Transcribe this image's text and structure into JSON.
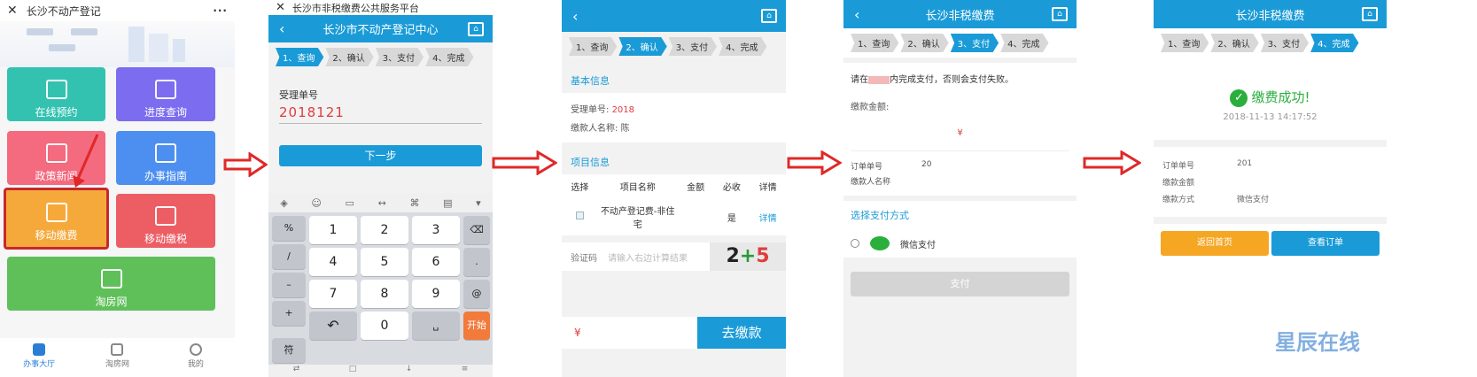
{
  "screen1": {
    "title": "长沙不动产登记",
    "menu": "···",
    "tiles": [
      {
        "label": "在线预约",
        "color": "#33c2b0"
      },
      {
        "label": "进度查询",
        "color": "#7b6cf0"
      },
      {
        "label": "政策新闻",
        "color": "#f46a7e"
      },
      {
        "label": "办事指南",
        "color": "#4d8ff0"
      },
      {
        "label": "移动缴费",
        "color": "#f6a93b"
      },
      {
        "label": "移动缴税",
        "color": "#ec5d64"
      },
      {
        "label": "淘房网",
        "color": "#5fc05a"
      }
    ],
    "nav": [
      "办事大厅",
      "淘房网",
      "我的"
    ]
  },
  "screen2": {
    "browser_title": "长沙市非税缴费公共服务平台",
    "header": "长沙市不动产登记中心",
    "steps": [
      "1、查询",
      "2、确认",
      "3、支付",
      "4、完成"
    ],
    "field_label": "受理单号",
    "field_value": "2018121",
    "next_button": "下一步",
    "keys_left": [
      "%",
      "/",
      "–",
      "+",
      "符"
    ],
    "keys_digits": [
      "1",
      "2",
      "3",
      "4",
      "5",
      "6",
      "7",
      "8",
      "9",
      "0"
    ],
    "keys_right": [
      ".",
      "@",
      "开始"
    ]
  },
  "screen3": {
    "steps": [
      "1、查询",
      "2、确认",
      "3、支付",
      "4、完成"
    ],
    "section_basic": "基本信息",
    "receipt_label": "受理单号:",
    "receipt_value": "2018",
    "payer_label": "缴款人名称:",
    "payer_value": "陈",
    "section_items": "项目信息",
    "table_headers": [
      "选择",
      "项目名称",
      "金额",
      "必收",
      "详情"
    ],
    "item_name": "不动产登记费-非住宅",
    "item_required": "是",
    "item_detail": "详情",
    "captcha_label": "验证码",
    "captcha_placeholder": "请输入右边计算结果",
    "captcha_a": "2",
    "captcha_b": "+",
    "captcha_c": "5",
    "currency": "¥",
    "pay_button": "去缴款"
  },
  "screen4": {
    "header": "长沙非税缴费",
    "steps": [
      "1、查询",
      "2、确认",
      "3、支付",
      "4、完成"
    ],
    "notice_pre": "请在",
    "notice_post": "内完成支付，否则会支付失败。",
    "amount_label": "缴款金额:",
    "currency": "¥",
    "order_label": "订单单号",
    "order_value": "20",
    "payer_label": "缴款人名称",
    "choose_method": "选择支付方式",
    "wechat_pay": "微信支付",
    "pay_button": "支付"
  },
  "screen5": {
    "header": "长沙非税缴费",
    "steps": [
      "1、查询",
      "2、确认",
      "3、支付",
      "4、完成"
    ],
    "success": "缴费成功!",
    "check": "✓",
    "time": "2018-11-13 14:17:52",
    "rows": [
      {
        "label": "订单单号",
        "value": "201"
      },
      {
        "label": "缴款金额",
        "value": ""
      },
      {
        "label": "缴款方式",
        "value": "微信支付"
      }
    ],
    "back_button": "返回首页",
    "view_order_button": "查看订单",
    "watermark": "星辰在线"
  },
  "colors": {
    "arrow": "#e02828",
    "brand_blue": "#1a9bd7"
  }
}
